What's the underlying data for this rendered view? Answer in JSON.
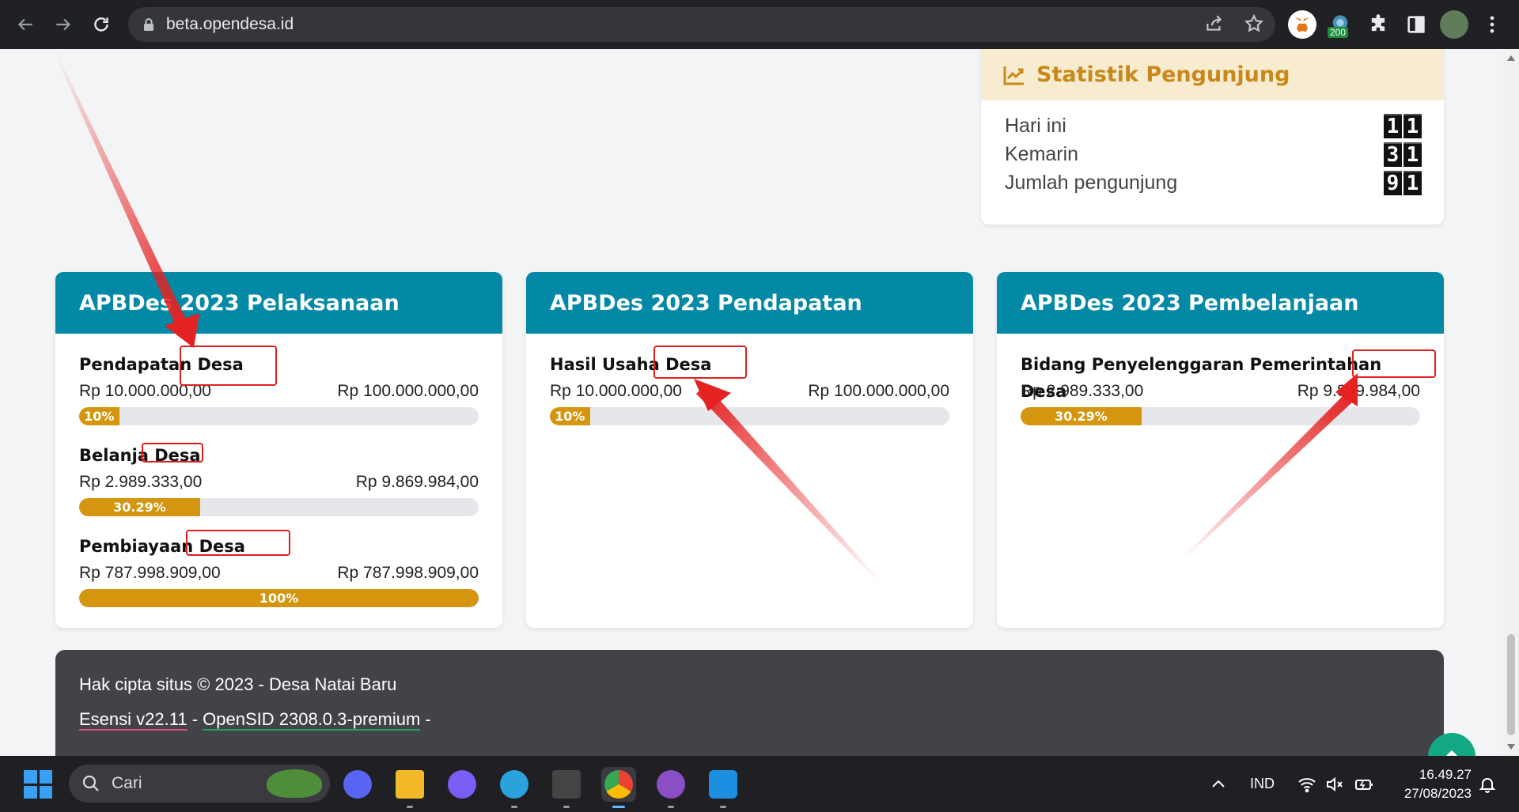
{
  "browser": {
    "url": "beta.opendesa.id",
    "ext_badge": "200"
  },
  "statistik": {
    "title": "Statistik Pengunjung",
    "rows": [
      {
        "label": "Hari ini",
        "digits": [
          "1",
          "1"
        ]
      },
      {
        "label": "Kemarin",
        "digits": [
          "3",
          "1"
        ]
      },
      {
        "label": "Jumlah pengunjung",
        "digits": [
          "9",
          "1"
        ]
      }
    ]
  },
  "cards": [
    {
      "title": "APBDes 2023 Pelaksanaan",
      "items": [
        {
          "name": "Pendapatan Desa",
          "realisasi": "Rp 10.000.000,00",
          "anggaran": "Rp 100.000.000,00",
          "percent_label": "10%",
          "percent": 10
        },
        {
          "name": "Belanja Desa",
          "realisasi": "Rp 2.989.333,00",
          "anggaran": "Rp 9.869.984,00",
          "percent_label": "30.29%",
          "percent": 30.29
        },
        {
          "name": "Pembiayaan Desa",
          "realisasi": "Rp 787.998.909,00",
          "anggaran": "Rp 787.998.909,00",
          "percent_label": "100%",
          "percent": 100
        }
      ]
    },
    {
      "title": "APBDes 2023 Pendapatan",
      "items": [
        {
          "name": "Hasil Usaha Desa",
          "realisasi": "Rp 10.000.000,00",
          "anggaran": "Rp 100.000.000,00",
          "percent_label": "10%",
          "percent": 10
        }
      ]
    },
    {
      "title": "APBDes 2023 Pembelanjaan",
      "items": [
        {
          "name": "Bidang Penyelenggaran Pemerintahan Desa",
          "realisasi": "Rp 2.989.333,00",
          "anggaran": "Rp 9.869.984,00",
          "percent_label": "30.29%",
          "percent": 30.29
        }
      ]
    }
  ],
  "footer": {
    "copyright": "Hak cipta situs © 2023 - Desa Natai Baru",
    "theme_link": "Esensi v22.11",
    "sep1": " - ",
    "opensid_link": "OpenSID 2308.0.3-premium",
    "sep2": " -"
  },
  "taskbar": {
    "search_placeholder": "Cari",
    "language": "IND",
    "time": "16.49.27",
    "date": "27/08/2023"
  }
}
